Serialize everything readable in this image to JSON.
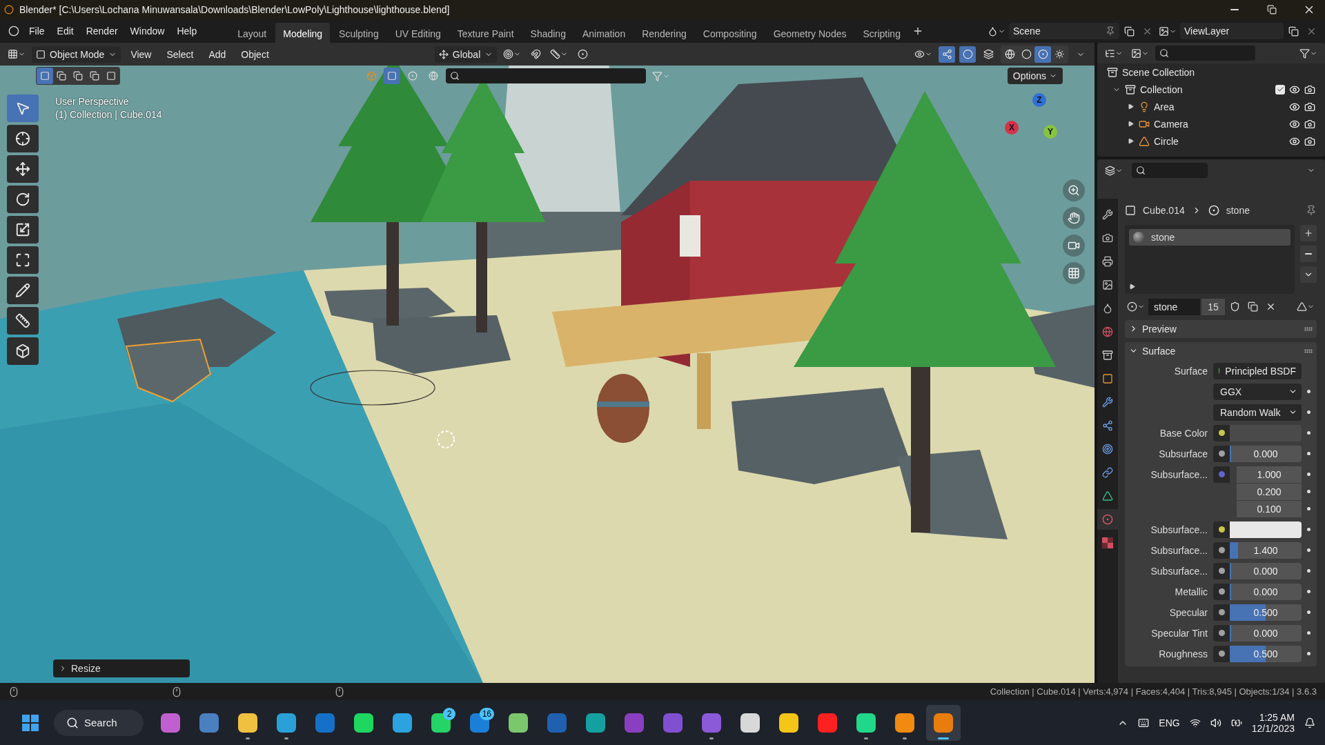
{
  "title_bar": {
    "title": "Blender* [C:\\Users\\Lochana Minuwansala\\Downloads\\Blender\\LowPoly\\Lighthouse\\lighthouse.blend]"
  },
  "menu": [
    "File",
    "Edit",
    "Render",
    "Window",
    "Help"
  ],
  "workspaces": [
    {
      "label": "Layout",
      "selected": false
    },
    {
      "label": "Modeling",
      "selected": true
    },
    {
      "label": "Sculpting",
      "selected": false
    },
    {
      "label": "UV Editing",
      "selected": false
    },
    {
      "label": "Texture Paint",
      "selected": false
    },
    {
      "label": "Shading",
      "selected": false
    },
    {
      "label": "Animation",
      "selected": false
    },
    {
      "label": "Rendering",
      "selected": false
    },
    {
      "label": "Compositing",
      "selected": false
    },
    {
      "label": "Geometry Nodes",
      "selected": false
    },
    {
      "label": "Scripting",
      "selected": false
    }
  ],
  "scene": "Scene",
  "view_layer": "ViewLayer",
  "viewport_header": {
    "mode": "Object Mode",
    "menus": [
      "View",
      "Select",
      "Add",
      "Object"
    ],
    "orientation": "Global",
    "toggles": [
      {
        "kind": "gizmo",
        "on": true
      },
      {
        "kind": "overlay",
        "on": true
      },
      {
        "kind": "xray",
        "on": false
      }
    ],
    "shading": [
      {
        "kind": "wireframe",
        "selected": false
      },
      {
        "kind": "solid",
        "selected": false
      },
      {
        "kind": "material",
        "selected": true
      },
      {
        "kind": "rendered",
        "selected": false
      }
    ]
  },
  "viewport": {
    "view_name": "User Perspective",
    "context": "(1) Collection | Cube.014",
    "options": "Options",
    "last_operator": "Resize",
    "tools": [
      {
        "kind": "select",
        "selected": true
      },
      {
        "kind": "cursor",
        "selected": false
      },
      {
        "kind": "move",
        "selected": false
      },
      {
        "kind": "rotate",
        "selected": false
      },
      {
        "kind": "scale",
        "selected": false
      },
      {
        "kind": "transform",
        "selected": false
      },
      {
        "kind": "annotate",
        "selected": false
      },
      {
        "kind": "measure",
        "selected": false
      },
      {
        "kind": "add-cube",
        "selected": false
      }
    ],
    "gizmo_axes": [
      {
        "label": "Z",
        "color": "#2f6fd6"
      },
      {
        "label": "X",
        "color": "#d6324a"
      },
      {
        "label": "Y",
        "color": "#86c440"
      }
    ]
  },
  "outliner": {
    "root": "Scene Collection",
    "items": [
      {
        "label": "Collection",
        "kind": "collection",
        "expanded": true,
        "checked": true,
        "children": [
          {
            "label": "Area",
            "kind": "light",
            "expanded": false
          },
          {
            "label": "Camera",
            "kind": "camera",
            "expanded": false
          },
          {
            "label": "Circle",
            "kind": "mesh",
            "expanded": false
          }
        ]
      }
    ]
  },
  "properties": {
    "tabs": [
      {
        "kind": "tool",
        "selected": false
      },
      {
        "kind": "render",
        "selected": false
      },
      {
        "kind": "output",
        "selected": false
      },
      {
        "kind": "view-layer",
        "selected": false
      },
      {
        "kind": "scene",
        "selected": false
      },
      {
        "kind": "world",
        "selected": false
      },
      {
        "kind": "collection",
        "selected": false
      },
      {
        "kind": "object",
        "selected": false
      },
      {
        "kind": "modifiers",
        "selected": false
      },
      {
        "kind": "particles",
        "selected": false
      },
      {
        "kind": "physics",
        "selected": false
      },
      {
        "kind": "constraints",
        "selected": false
      },
      {
        "kind": "data",
        "selected": false
      },
      {
        "kind": "material",
        "selected": true
      },
      {
        "kind": "texture",
        "selected": false
      }
    ],
    "breadcrumb": [
      "Cube.014",
      "stone"
    ],
    "slots": [
      {
        "label": "stone",
        "selected": true
      }
    ],
    "material": {
      "name": "stone",
      "users": "15"
    },
    "panels": [
      {
        "label": "Preview",
        "expanded": false
      },
      {
        "label": "Surface",
        "expanded": true
      }
    ],
    "rows": [
      {
        "kind": "link",
        "label": "Surface",
        "value": "Principled BSDF",
        "color": "#4fc04f"
      },
      {
        "kind": "dropdown",
        "value": "GGX"
      },
      {
        "kind": "dropdown",
        "value": "Random Walk"
      },
      {
        "kind": "color",
        "label": "Base Color",
        "color": "#c7c74a",
        "swatch": {
          "color": "#4a4a4a"
        }
      },
      {
        "kind": "number",
        "label": "Subsurface",
        "color": "#a1a1a1",
        "value": "0.000",
        "level": 0
      },
      {
        "kind": "vector",
        "label": "Subsurface...",
        "color": "#6363c7",
        "values": [
          "1.000",
          "0.200",
          "0.100"
        ]
      },
      {
        "kind": "color",
        "label": "Subsurface...",
        "color": "#c7c74a",
        "swatch": {
          "color": "#e8e8e8"
        }
      },
      {
        "kind": "number",
        "label": "Subsurface...",
        "color": "#a1a1a1",
        "value": "1.400",
        "level": 0.12
      },
      {
        "kind": "number",
        "label": "Subsurface...",
        "color": "#a1a1a1",
        "value": "0.000",
        "level": 0
      },
      {
        "kind": "number",
        "label": "Metallic",
        "color": "#a1a1a1",
        "value": "0.000",
        "level": 0
      },
      {
        "kind": "number",
        "label": "Specular",
        "color": "#a1a1a1",
        "value": "0.500",
        "level": 0.5
      },
      {
        "kind": "number",
        "label": "Specular Tint",
        "color": "#a1a1a1",
        "value": "0.000",
        "level": 0
      },
      {
        "kind": "number",
        "label": "Roughness",
        "color": "#a1a1a1",
        "value": "0.500",
        "level": 0.5
      }
    ]
  },
  "status_bar": {
    "text": "Collection | Cube.014 | Verts:4,974 | Faces:4,404 | Tris:8,945 | Objects:1/34 | 3.6.3"
  },
  "taskbar": {
    "search": "Search",
    "apps": [
      {
        "color": "#c060d0",
        "running": false,
        "selected": false
      },
      {
        "color": "#4a7fc0",
        "running": false,
        "selected": false
      },
      {
        "color": "#f0c040",
        "running": true,
        "selected": false
      },
      {
        "color": "#2aa0d8",
        "running": true,
        "selected": false
      },
      {
        "color": "#1570c8",
        "running": false,
        "selected": false
      },
      {
        "color": "#1ed760",
        "running": false,
        "selected": false
      },
      {
        "color": "#2aa3e0",
        "running": false,
        "selected": false
      },
      {
        "color": "#25d366",
        "running": false,
        "selected": false,
        "badge": "2"
      },
      {
        "color": "#1b7fd8",
        "running": false,
        "selected": false,
        "badge": "16"
      },
      {
        "color": "#7bc86c",
        "running": false,
        "selected": false
      },
      {
        "color": "#2060b0",
        "running": false,
        "selected": false
      },
      {
        "color": "#14a0a0",
        "running": false,
        "selected": false
      },
      {
        "color": "#8a3fc0",
        "running": false,
        "selected": false
      },
      {
        "color": "#8050d0",
        "running": false,
        "selected": false
      },
      {
        "color": "#8a5ad8",
        "running": true,
        "selected": false
      },
      {
        "color": "#d8d8d8",
        "running": false,
        "selected": false
      },
      {
        "color": "#f5c518",
        "running": false,
        "selected": false
      },
      {
        "color": "#ff2020",
        "running": false,
        "selected": false
      },
      {
        "color": "#21d789",
        "running": true,
        "selected": false
      },
      {
        "color": "#f08a10",
        "running": true,
        "selected": false
      },
      {
        "color": "#e87d0d",
        "running": true,
        "selected": true
      }
    ],
    "language": "ENG",
    "time": "1:25 AM",
    "date": "12/1/2023"
  }
}
